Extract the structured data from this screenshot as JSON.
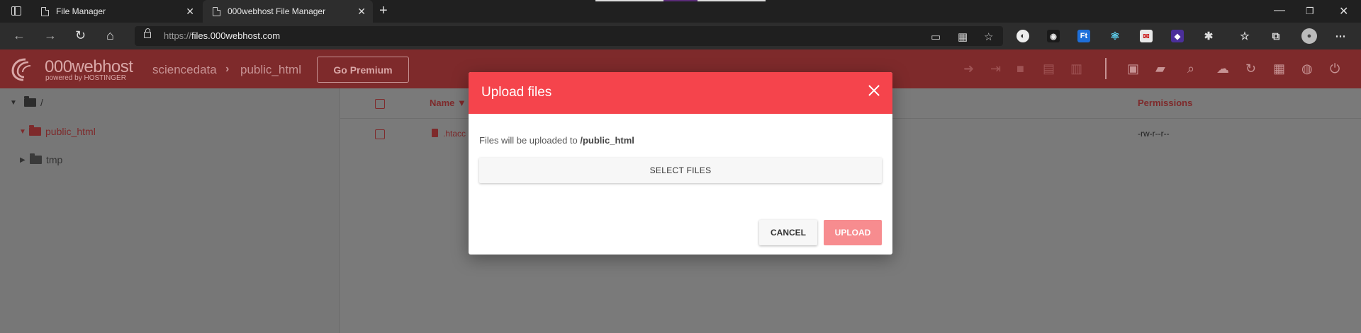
{
  "browser": {
    "tabs": [
      {
        "title": "File Manager"
      },
      {
        "title": "000webhost File Manager",
        "active": true
      }
    ],
    "url_protocol": "https://",
    "url_host": "files.000webhost.com"
  },
  "app": {
    "logo_text": "000webhost",
    "logo_subtext": "powered by HOSTINGER",
    "breadcrumb": [
      "sciencedata",
      "public_html"
    ],
    "premium_label": "Go Premium",
    "colors": {
      "header": "#7e2a2b",
      "accent": "#f5444c",
      "upload_disabled": "#f78c8f"
    }
  },
  "sidebar": {
    "items": [
      {
        "label": "/",
        "expanded": true
      },
      {
        "label": "public_html",
        "expanded": true,
        "selected": true
      },
      {
        "label": "tmp",
        "expanded": false
      }
    ]
  },
  "listing": {
    "columns": {
      "name": "Name ▼",
      "permissions": "Permissions"
    },
    "rows": [
      {
        "name": ".htacc",
        "permissions": "-rw-r--r--"
      }
    ]
  },
  "modal": {
    "title": "Upload files",
    "message_prefix": "Files will be uploaded to ",
    "message_path": "/public_html",
    "select_label": "SELECT FILES",
    "cancel_label": "CANCEL",
    "upload_label": "UPLOAD"
  }
}
